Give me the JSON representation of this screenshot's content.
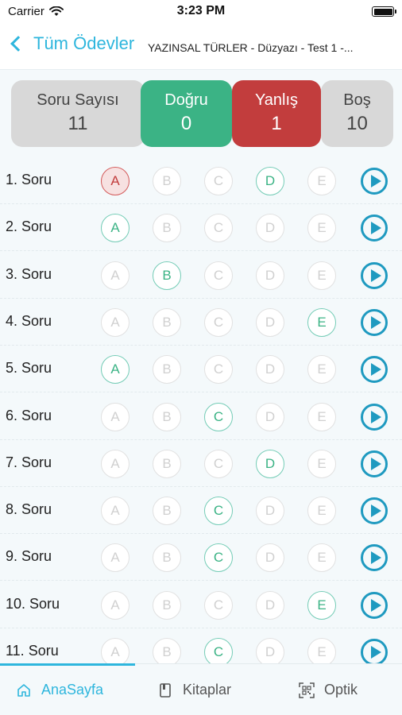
{
  "status_bar": {
    "carrier": "Carrier",
    "time": "3:23 PM"
  },
  "nav": {
    "back_label": "Tüm Ödevler",
    "title": "YAZINSAL TÜRLER - Düzyazı - Test 1 -..."
  },
  "summary": {
    "total_label": "Soru Sayısı",
    "total_value": "11",
    "correct_label": "Doğru",
    "correct_value": "0",
    "wrong_label": "Yanlış",
    "wrong_value": "1",
    "empty_label": "Boş",
    "empty_value": "10"
  },
  "options": [
    "A",
    "B",
    "C",
    "D",
    "E"
  ],
  "questions": [
    {
      "label": "1. Soru",
      "marked": "A",
      "status": "wrong",
      "correct": "D"
    },
    {
      "label": "2. Soru",
      "marked": null,
      "status": "empty",
      "correct": "A"
    },
    {
      "label": "3. Soru",
      "marked": null,
      "status": "empty",
      "correct": "B"
    },
    {
      "label": "4. Soru",
      "marked": null,
      "status": "empty",
      "correct": "E"
    },
    {
      "label": "5. Soru",
      "marked": null,
      "status": "empty",
      "correct": "A"
    },
    {
      "label": "6. Soru",
      "marked": null,
      "status": "empty",
      "correct": "C"
    },
    {
      "label": "7. Soru",
      "marked": null,
      "status": "empty",
      "correct": "D"
    },
    {
      "label": "8. Soru",
      "marked": null,
      "status": "empty",
      "correct": "C"
    },
    {
      "label": "9. Soru",
      "marked": null,
      "status": "empty",
      "correct": "C"
    },
    {
      "label": "10. Soru",
      "marked": null,
      "status": "empty",
      "correct": "E"
    },
    {
      "label": "11. Soru",
      "marked": null,
      "status": "empty",
      "correct": "C"
    }
  ],
  "tabs": [
    {
      "label": "AnaSayfa",
      "icon": "home-icon",
      "active": true
    },
    {
      "label": "Kitaplar",
      "icon": "book-icon",
      "active": false
    },
    {
      "label": "Optik",
      "icon": "qr-scan-icon",
      "active": false
    }
  ],
  "colors": {
    "accent": "#2eb6dd",
    "correct": "#3bb385",
    "wrong": "#c23d3d",
    "neutral": "#d8d8d8"
  }
}
